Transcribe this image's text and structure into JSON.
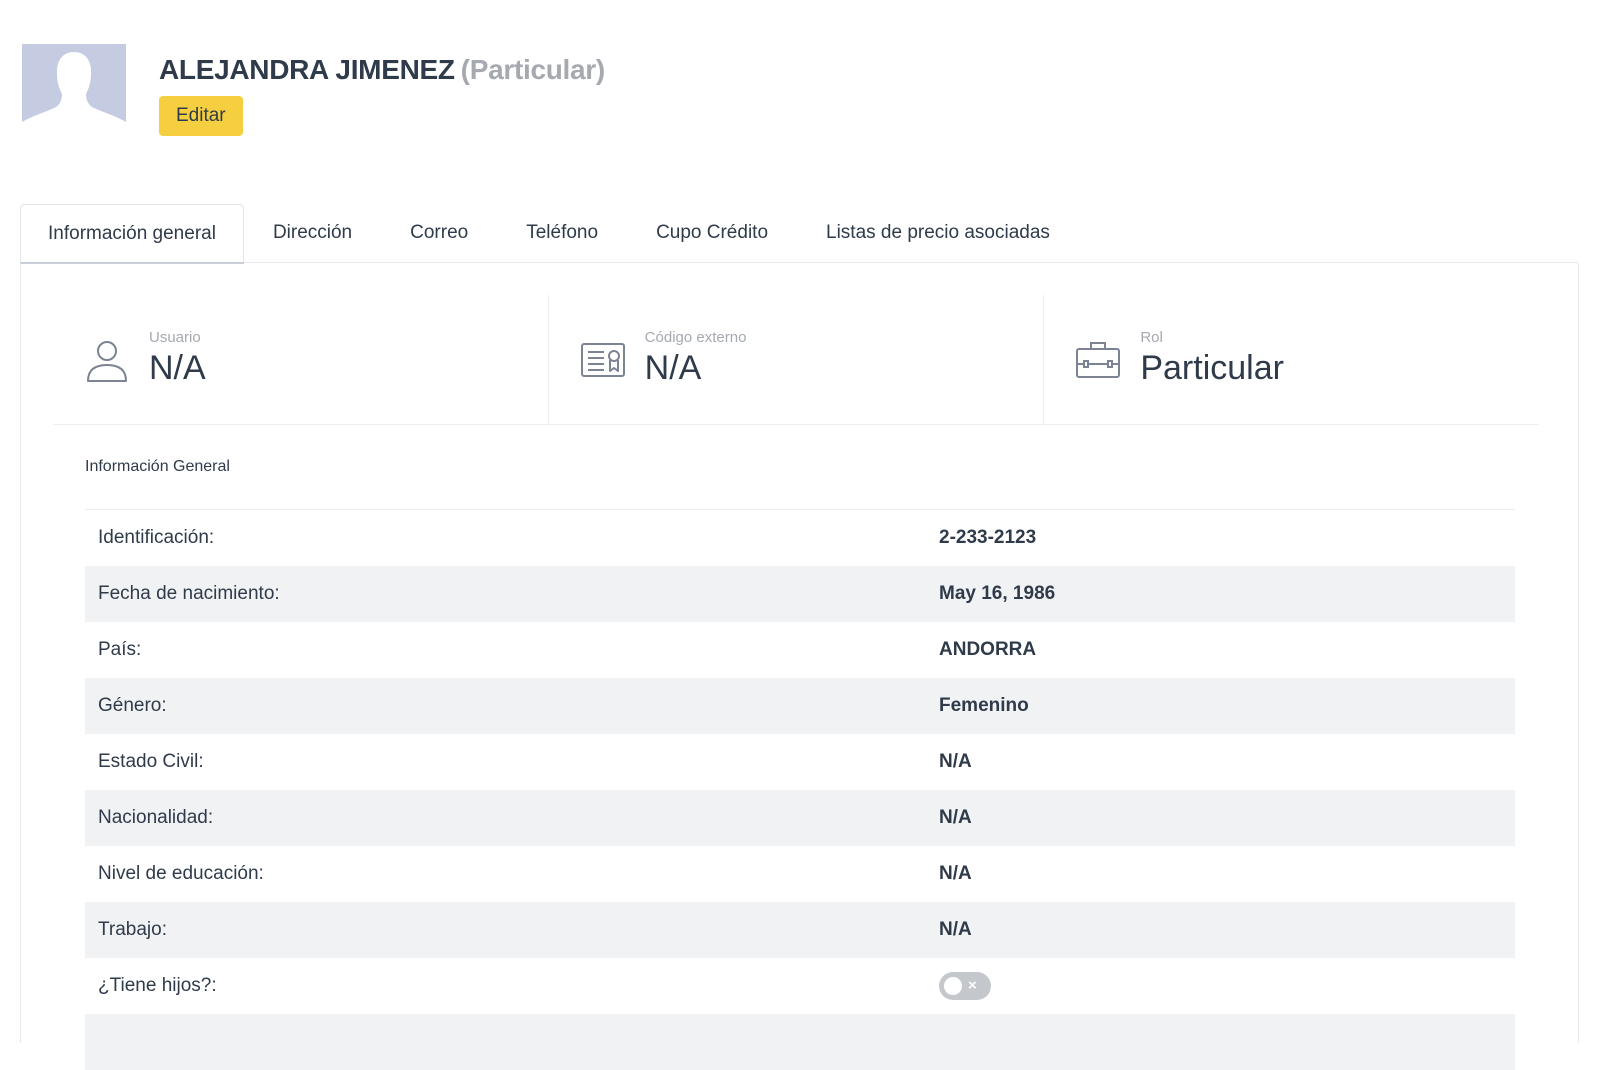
{
  "header": {
    "name": "ALEJANDRA JIMENEZ",
    "type_label": "(Particular)",
    "edit_label": "Editar"
  },
  "tabs": [
    {
      "label": "Información general",
      "active": true
    },
    {
      "label": "Dirección",
      "active": false
    },
    {
      "label": "Correo",
      "active": false
    },
    {
      "label": "Teléfono",
      "active": false
    },
    {
      "label": "Cupo Crédito",
      "active": false
    },
    {
      "label": "Listas de precio asociadas",
      "active": false
    }
  ],
  "stats": [
    {
      "icon": "user-icon",
      "label": "Usuario",
      "value": "N/A"
    },
    {
      "icon": "id-card-icon",
      "label": "Código externo",
      "value": "N/A"
    },
    {
      "icon": "briefcase-icon",
      "label": "Rol",
      "value": "Particular"
    }
  ],
  "section": {
    "title": "Información General"
  },
  "info_rows": [
    {
      "label": "Identificación:",
      "value": "2-233-2123"
    },
    {
      "label": "Fecha de nacimiento:",
      "value": "May 16, 1986"
    },
    {
      "label": "País:",
      "value": "ANDORRA"
    },
    {
      "label": "Género:",
      "value": "Femenino"
    },
    {
      "label": "Estado Civil:",
      "value": "N/A"
    },
    {
      "label": "Nacionalidad:",
      "value": "N/A"
    },
    {
      "label": "Nivel de educación:",
      "value": "N/A"
    },
    {
      "label": "Trabajo:",
      "value": "N/A"
    },
    {
      "label": "¿Tiene hijos?:",
      "toggle": false,
      "toggle_symbol": "×"
    }
  ],
  "colors": {
    "edit_button": "#f5cf3f",
    "avatar_bg": "#c5cbe0",
    "text": "#2f3b4a",
    "muted": "#a5a9b0",
    "row_alt": "#f1f2f4"
  }
}
